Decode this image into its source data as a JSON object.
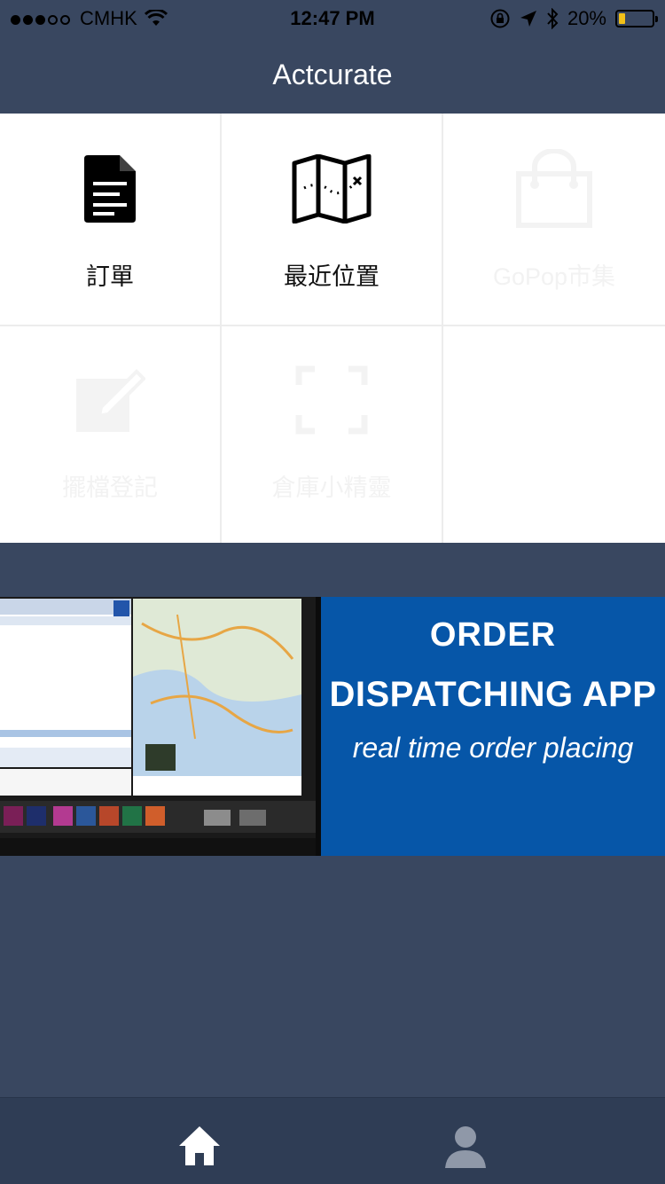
{
  "status_bar": {
    "carrier": "CMHK",
    "time": "12:47 PM",
    "battery": "20%",
    "battery_level": 0.2
  },
  "navbar": {
    "title": "Actcurate"
  },
  "grid": {
    "items": [
      {
        "label": "訂單",
        "icon": "document-icon",
        "enabled": true
      },
      {
        "label": "最近位置",
        "icon": "map-icon",
        "enabled": true
      },
      {
        "label": "GoPop市集",
        "icon": "shopping-bag-icon",
        "enabled": false
      },
      {
        "label": "擺檔登記",
        "icon": "edit-icon",
        "enabled": false
      },
      {
        "label": "倉庫小精靈",
        "icon": "scan-frame-icon",
        "enabled": false
      }
    ]
  },
  "banner": {
    "line1": "ORDER",
    "line2": "DISPATCHING APP",
    "line3": "real time order placing"
  },
  "tab_bar": {
    "items": [
      {
        "icon": "home-icon",
        "active": true
      },
      {
        "icon": "user-icon",
        "active": false
      }
    ]
  },
  "colors": {
    "background": "#394760",
    "banner_blue": "#0656a8",
    "tab_bar": "#2f3d55",
    "battery_fill": "#f2c018"
  }
}
